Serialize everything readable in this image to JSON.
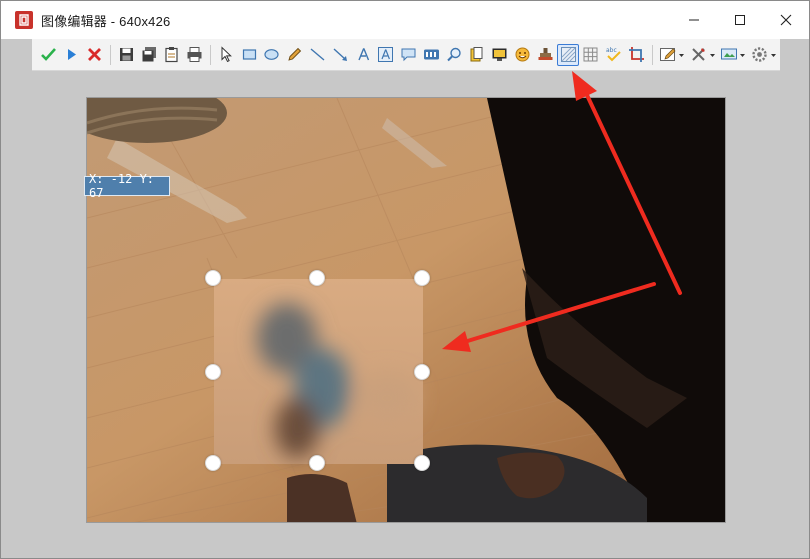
{
  "window": {
    "title": "图像编辑器 - 640x426"
  },
  "toolbar": {
    "buttons": [
      {
        "name": "confirm-icon",
        "color": "#2bb24c"
      },
      {
        "name": "forward-icon",
        "color": "#2a7fd6"
      },
      {
        "name": "cancel-icon",
        "color": "#d92b2b"
      },
      {
        "name": "save-icon"
      },
      {
        "name": "save-all-icon"
      },
      {
        "name": "clipboard-icon"
      },
      {
        "name": "print-icon"
      },
      {
        "name": "cursor-icon"
      },
      {
        "name": "rectangle-icon"
      },
      {
        "name": "ellipse-icon"
      },
      {
        "name": "pencil-icon"
      },
      {
        "name": "line-icon"
      },
      {
        "name": "arrow-line-icon"
      },
      {
        "name": "text-icon"
      },
      {
        "name": "textbox-icon"
      },
      {
        "name": "speech-bubble-icon"
      },
      {
        "name": "counter-icon"
      },
      {
        "name": "magnifier-icon"
      },
      {
        "name": "highlighter-icon"
      },
      {
        "name": "image-icon"
      },
      {
        "name": "emoji-icon"
      },
      {
        "name": "stamp-icon"
      },
      {
        "name": "blur-icon",
        "active": true
      },
      {
        "name": "grid-icon"
      },
      {
        "name": "spell-check-icon"
      },
      {
        "name": "crop-icon"
      },
      {
        "name": "edit-menu-icon"
      },
      {
        "name": "tools-menu-icon"
      },
      {
        "name": "export-menu-icon"
      },
      {
        "name": "settings-menu-icon"
      }
    ]
  },
  "canvas": {
    "coordinates": "X: -12 Y: 67"
  },
  "colors": {
    "accent": "#3a7bd5",
    "annotation_arrow": "#ef2b1f",
    "label_bg": "#4f7fac"
  }
}
